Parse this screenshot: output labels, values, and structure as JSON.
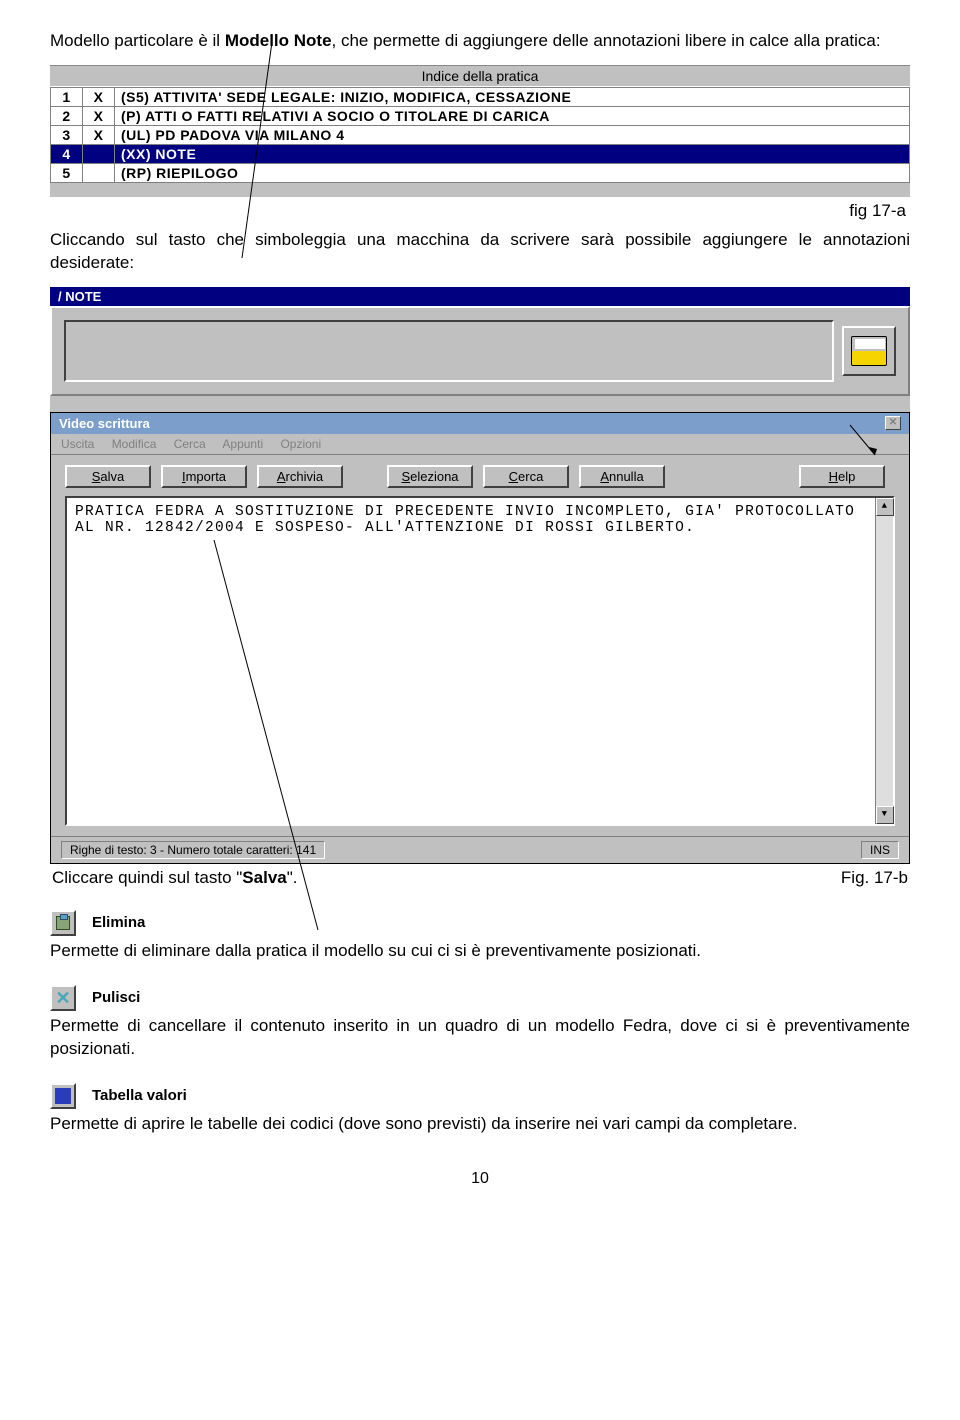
{
  "intro": {
    "pre": "Modello particolare è il ",
    "bold": "Modello Note",
    "post": ", che permette di aggiungere delle annotazioni libere in calce alla pratica:"
  },
  "indice": {
    "header": "Indice della pratica",
    "rows": [
      {
        "n": "1",
        "x": "X",
        "t": "(S5)  ATTIVITA' SEDE LEGALE: INIZIO, MODIFICA, CESSAZIONE"
      },
      {
        "n": "2",
        "x": "X",
        "t": "(P)  ATTI O FATTI RELATIVI A SOCIO O TITOLARE DI CARICA"
      },
      {
        "n": "3",
        "x": "X",
        "t": "(UL)  PD PADOVA VIA MILANO 4"
      },
      {
        "n": "4",
        "x": "",
        "t": "(XX)  NOTE",
        "sel": true
      },
      {
        "n": "5",
        "x": "",
        "t": "(RP)  RIEPILOGO"
      }
    ]
  },
  "fig_a": "fig 17-a",
  "para2": "Cliccando sul tasto che simboleggia una macchina da scrivere sarà possibile aggiungere le annotazioni desiderate:",
  "note": {
    "title": "/ NOTE"
  },
  "vs": {
    "title": "Video scrittura",
    "menu": [
      "Uscita",
      "Modifica",
      "Cerca",
      "Appunti",
      "Opzioni"
    ],
    "buttons": {
      "salva": "Salva",
      "importa": "Importa",
      "archivia": "Archivia",
      "seleziona": "Seleziona",
      "cerca": "Cerca",
      "annulla": "Annulla",
      "help": "Help"
    },
    "text": "PRATICA FEDRA A SOSTITUZIONE DI PRECEDENTE INVIO INCOMPLETO, GIA' PROTOCOLLATO AL NR. 12842/2004 E SOSPESO- ALL'ATTENZIONE DI ROSSI GILBERTO.",
    "status_left": "Righe di testo: 3 - Numero totale caratteri: 141",
    "status_right": "INS"
  },
  "after": {
    "left_pre": "Cliccare quindi sul tasto \"",
    "left_bold": "Salva",
    "left_post": "\".",
    "right": "Fig. 17-b"
  },
  "sec_elimina": {
    "label": "Elimina",
    "body": "Permette di eliminare dalla pratica il modello su cui ci si è preventivamente posizionati."
  },
  "sec_pulisci": {
    "label": "Pulisci",
    "body": "Permette di cancellare il contenuto inserito in un quadro di un modello Fedra, dove ci si è preventivamente posizionati."
  },
  "sec_tabella": {
    "label": "Tabella valori",
    "body": "Permette di aprire le tabelle dei codici (dove sono previsti) da inserire nei vari campi da completare."
  },
  "page_num": "10"
}
